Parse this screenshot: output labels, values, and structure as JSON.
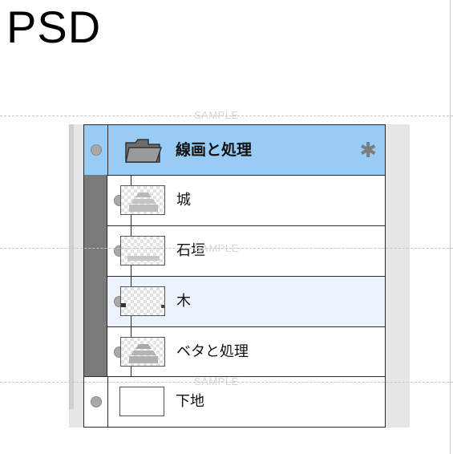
{
  "page_title": "PSD",
  "watermark": "SAMPLE",
  "layers_panel": {
    "group": {
      "name": "線画と処理",
      "icon": "folder-icon",
      "settings_icon": "gear-icon",
      "highlight_color": "#99ccf5"
    },
    "children": [
      {
        "name": "城",
        "thumbnail": "castle-thumbnail"
      },
      {
        "name": "石垣",
        "thumbnail": "stone-wall-thumbnail"
      },
      {
        "name": "木",
        "thumbnail": "tree-thumbnail",
        "selected": true,
        "selected_color": "#edf3fd"
      },
      {
        "name": "ベタと処理",
        "thumbnail": "fill-thumbnail"
      }
    ],
    "base_layer": {
      "name": "下地"
    }
  }
}
